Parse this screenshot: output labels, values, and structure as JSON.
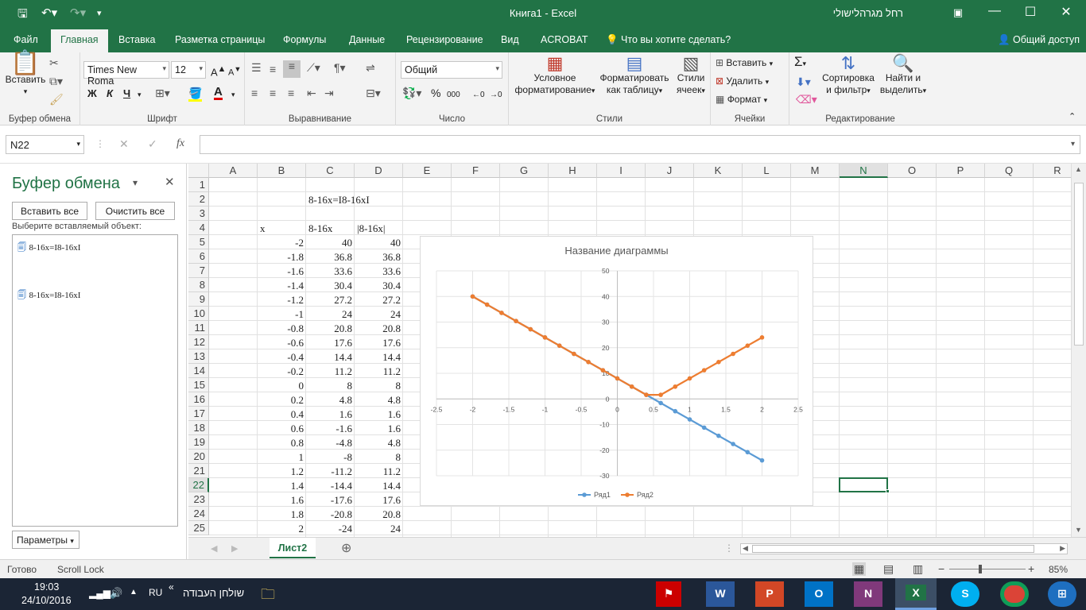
{
  "window": {
    "title": "Книга1  -  Excel",
    "user": "רחל מגרהלישולי"
  },
  "tabs": [
    "Файл",
    "Главная",
    "Вставка",
    "Разметка страницы",
    "Формулы",
    "Данные",
    "Рецензирование",
    "Вид",
    "ACROBAT"
  ],
  "tell_me": "Что вы хотите сделать?",
  "share": "Общий доступ",
  "ribbon": {
    "clipboard": {
      "label": "Буфер обмена",
      "paste": "Вставить"
    },
    "font": {
      "label": "Шрифт",
      "name": "Times New Roma",
      "size": "12",
      "bold": "Ж",
      "italic": "К",
      "underline": "Ч",
      "color_a": "A"
    },
    "align": {
      "label": "Выравнивание"
    },
    "number": {
      "label": "Число",
      "format": "Общий",
      "percent": "%",
      "thousands": "000"
    },
    "styles": {
      "label": "Стили",
      "cond1": "Условное",
      "cond2": "форматирование",
      "table1": "Форматировать",
      "table2": "как таблицу",
      "cell1": "Стили",
      "cell2": "ячеек"
    },
    "cells": {
      "label": "Ячейки",
      "insert": "Вставить",
      "delete": "Удалить",
      "format": "Формат"
    },
    "edit": {
      "label": "Редактирование",
      "sort1": "Сортировка",
      "sort2": "и фильтр",
      "find1": "Найти и",
      "find2": "выделить",
      "sigma": "Σ"
    }
  },
  "formula": {
    "namebox": "N22",
    "fx": "fx",
    "value": ""
  },
  "clipboard_pane": {
    "title": "Буфер обмена",
    "paste_all": "Вставить все",
    "clear_all": "Очистить все",
    "hint": "Выберите вставляемый объект:",
    "items": [
      "8-16x=I8-16xI",
      "8-16x=I8-16xI"
    ],
    "options": "Параметры"
  },
  "sheet": {
    "columns": [
      "A",
      "B",
      "C",
      "D",
      "E",
      "F",
      "G",
      "H",
      "I",
      "J",
      "K",
      "L",
      "M",
      "N",
      "O",
      "P",
      "Q",
      "R"
    ],
    "rows": [
      "1",
      "2",
      "3",
      "4",
      "5",
      "6",
      "7",
      "8",
      "9",
      "10",
      "11",
      "12",
      "13",
      "14",
      "15",
      "16",
      "17",
      "18",
      "19",
      "20",
      "21",
      "22",
      "23",
      "24",
      "25"
    ],
    "c2": "8-16x=I8-16xI",
    "b4": "x",
    "c4": "8-16x",
    "d4": "|8-16x|",
    "data": [
      [
        "-2",
        "40",
        "40"
      ],
      [
        "-1.8",
        "36.8",
        "36.8"
      ],
      [
        "-1.6",
        "33.6",
        "33.6"
      ],
      [
        "-1.4",
        "30.4",
        "30.4"
      ],
      [
        "-1.2",
        "27.2",
        "27.2"
      ],
      [
        "-1",
        "24",
        "24"
      ],
      [
        "-0.8",
        "20.8",
        "20.8"
      ],
      [
        "-0.6",
        "17.6",
        "17.6"
      ],
      [
        "-0.4",
        "14.4",
        "14.4"
      ],
      [
        "-0.2",
        "11.2",
        "11.2"
      ],
      [
        "0",
        "8",
        "8"
      ],
      [
        "0.2",
        "4.8",
        "4.8"
      ],
      [
        "0.4",
        "1.6",
        "1.6"
      ],
      [
        "0.6",
        "-1.6",
        "1.6"
      ],
      [
        "0.8",
        "-4.8",
        "4.8"
      ],
      [
        "1",
        "-8",
        "8"
      ],
      [
        "1.2",
        "-11.2",
        "11.2"
      ],
      [
        "1.4",
        "-14.4",
        "14.4"
      ],
      [
        "1.6",
        "-17.6",
        "17.6"
      ],
      [
        "1.8",
        "-20.8",
        "20.8"
      ],
      [
        "2",
        "-24",
        "24"
      ]
    ],
    "tab": "Лист2"
  },
  "chart_data": {
    "type": "scatter",
    "title": "Название диаграммы",
    "x": [
      -2,
      -1.8,
      -1.6,
      -1.4,
      -1.2,
      -1,
      -0.8,
      -0.6,
      -0.4,
      -0.2,
      0,
      0.2,
      0.4,
      0.6,
      0.8,
      1,
      1.2,
      1.4,
      1.6,
      1.8,
      2
    ],
    "series": [
      {
        "name": "Ряд1",
        "color": "#5b9bd5",
        "values": [
          40,
          36.8,
          33.6,
          30.4,
          27.2,
          24,
          20.8,
          17.6,
          14.4,
          11.2,
          8,
          4.8,
          1.6,
          -1.6,
          -4.8,
          -8,
          -11.2,
          -14.4,
          -17.6,
          -20.8,
          -24
        ]
      },
      {
        "name": "Ряд2",
        "color": "#ed7d31",
        "values": [
          40,
          36.8,
          33.6,
          30.4,
          27.2,
          24,
          20.8,
          17.6,
          14.4,
          11.2,
          8,
          4.8,
          1.6,
          1.6,
          4.8,
          8,
          11.2,
          14.4,
          17.6,
          20.8,
          24
        ]
      }
    ],
    "xlim": [
      -2.5,
      2.5
    ],
    "ylim": [
      -30,
      50
    ],
    "xticks": [
      "-2.5",
      "-2",
      "-1.5",
      "-1",
      "-0.5",
      "0",
      "0.5",
      "1",
      "1.5",
      "2",
      "2.5"
    ],
    "yticks": [
      "50",
      "40",
      "30",
      "20",
      "10",
      "0",
      "-10",
      "-20",
      "-30"
    ],
    "grid": true,
    "legend": "bottom"
  },
  "status": {
    "ready": "Готово",
    "scroll": "Scroll Lock",
    "zoom": "85%"
  },
  "taskbar": {
    "time": "19:03",
    "date": "24/10/2016",
    "lang": "RU",
    "desktop": "שולחן העבודה"
  },
  "colors": {
    "excel_green": "#217346",
    "selection": "#217346"
  }
}
